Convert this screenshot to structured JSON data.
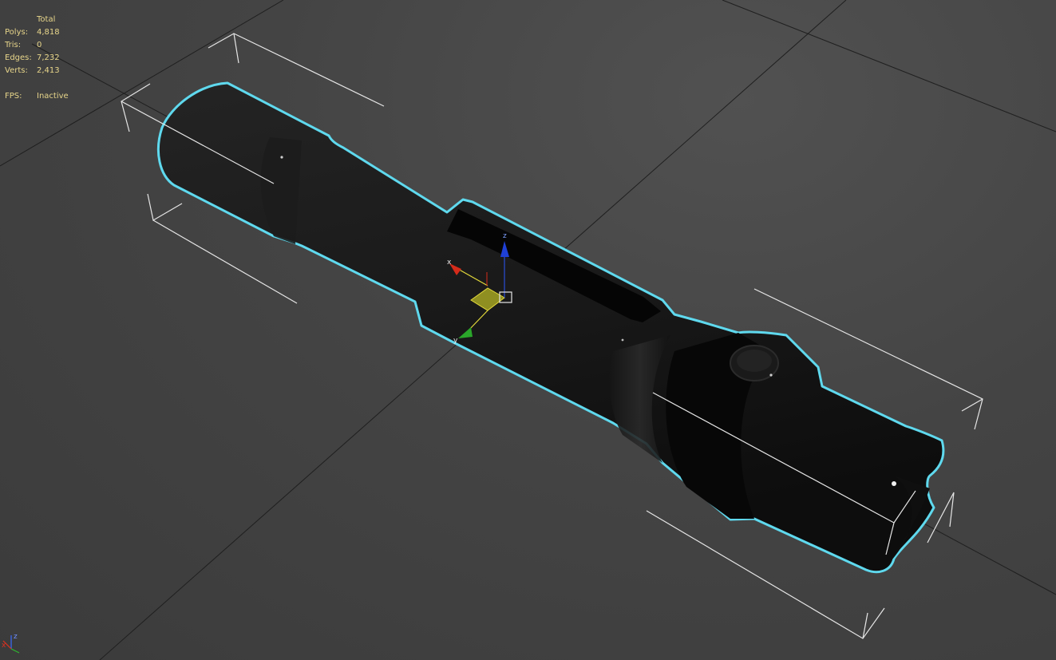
{
  "stats": {
    "header": "Total",
    "rows": [
      {
        "label": "Polys:",
        "value": "4,818"
      },
      {
        "label": "Tris:",
        "value": "0"
      },
      {
        "label": "Edges:",
        "value": "7,232"
      },
      {
        "label": "Verts:",
        "value": "2,413"
      }
    ],
    "fps_label": "FPS:",
    "fps_value": "Inactive"
  },
  "gizmo": {
    "x_label": "x",
    "y_label": "y",
    "z_label": "z"
  },
  "corner_axis": {
    "x_label": "x",
    "z_label": "z"
  },
  "colors": {
    "stats_text": "#e7d58a",
    "selection_outline": "#5fd9ee",
    "axis_x": "#e0301e",
    "axis_y": "#2fb52f",
    "axis_z": "#2a4fd8",
    "background": "#474747"
  },
  "icons": [
    "move-gizmo-icon",
    "view-axis-tripod-icon"
  ]
}
